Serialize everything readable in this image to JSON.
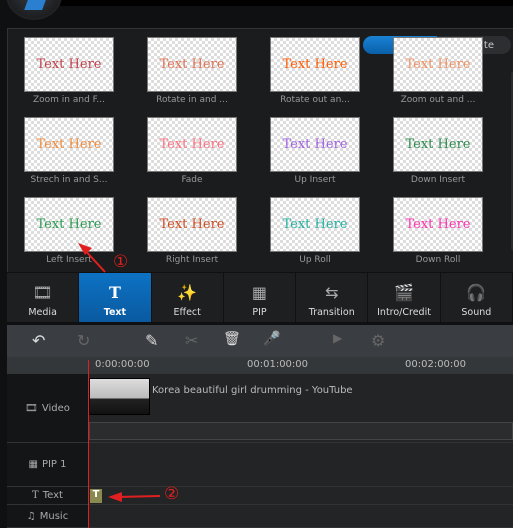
{
  "filter": {
    "all": "All",
    "favorite": "Favorite"
  },
  "sample_text": "Text Here",
  "effects": [
    {
      "label": "Zoom in and F...",
      "color": "#c0404a"
    },
    {
      "label": "Rotate in and ...",
      "color": "#e07050"
    },
    {
      "label": "Rotate out an...",
      "color": "#ff5a00"
    },
    {
      "label": "Zoom out and ...",
      "color": "#f09060"
    },
    {
      "label": "Strech in and S...",
      "color": "#f08a3a"
    },
    {
      "label": "Fade",
      "color": "#ff7080"
    },
    {
      "label": "Up Insert",
      "color": "#a060e0"
    },
    {
      "label": "Down Insert",
      "color": "#2a8a4a"
    },
    {
      "label": "Left Insert",
      "color": "#2a9a50"
    },
    {
      "label": "Right Insert",
      "color": "#d04a20"
    },
    {
      "label": "Up Roll",
      "color": "#20b0a0"
    },
    {
      "label": "Down Roll",
      "color": "#ff30b0"
    }
  ],
  "tabs": [
    {
      "label": "Media",
      "icon": "media-icon",
      "glyph": "🎞"
    },
    {
      "label": "Text",
      "icon": "text-icon",
      "glyph": "T"
    },
    {
      "label": "Effect",
      "icon": "magic-wand-icon",
      "glyph": "✨"
    },
    {
      "label": "PIP",
      "icon": "pip-icon",
      "glyph": "▦"
    },
    {
      "label": "Transition",
      "icon": "transition-icon",
      "glyph": "⇆"
    },
    {
      "label": "Intro/Credit",
      "icon": "clapper-icon",
      "glyph": "🎬"
    },
    {
      "label": "Sound",
      "icon": "headphones-icon",
      "glyph": "🎧"
    }
  ],
  "toolbar": {
    "undo": "↶",
    "redo": "↻",
    "edit": "✎",
    "cut": "✂",
    "delete": "🗑",
    "record": "🎤",
    "preview": "▶",
    "settings": "⚙"
  },
  "ruler": [
    "0:00:00:00",
    "00:01:00:00",
    "00:02:00:00"
  ],
  "tracks": {
    "video": "Video",
    "pip": "PIP 1",
    "text": "Text",
    "music": "Music"
  },
  "clip": {
    "title": "Korea beautiful girl drumming - YouTube"
  },
  "text_clip": "T",
  "annotations": {
    "one": "①",
    "two": "②"
  },
  "accent": "#0d72c4"
}
